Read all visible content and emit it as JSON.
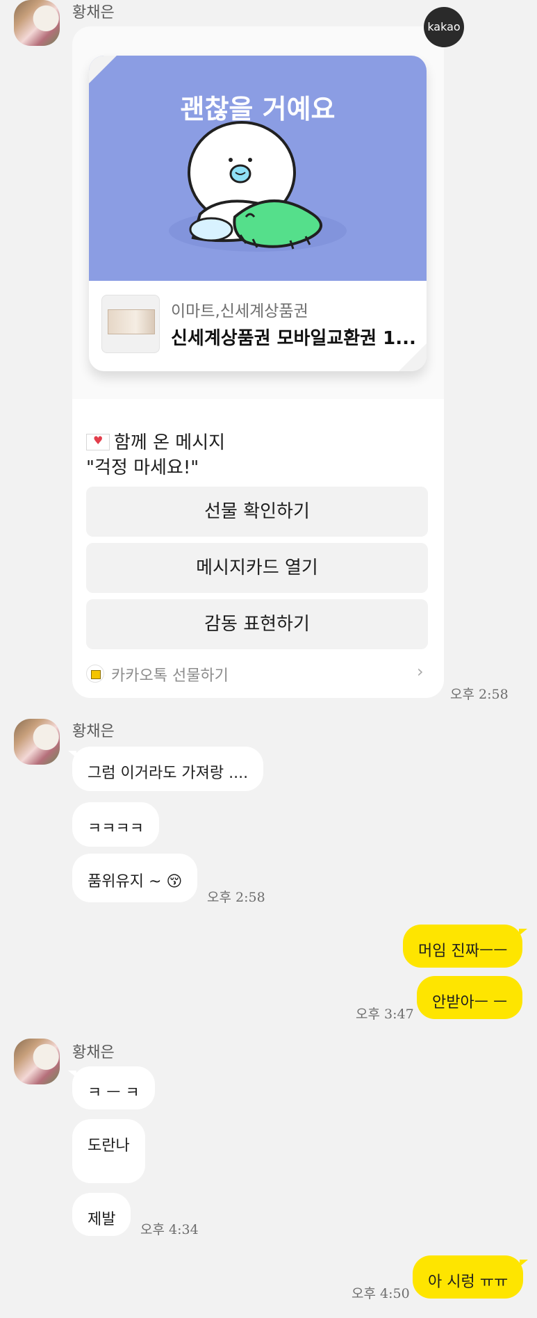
{
  "sender_name": "황채은",
  "gift_card": {
    "badge": "kakao",
    "image_title": "괜찮을 거예요",
    "brand": "이마트,신세계상품권",
    "product": "신세계상품권 모바일교환권 1...",
    "message_label": "함께 온 메시지",
    "message_text": "\"걱정 마세요!\"",
    "buttons": [
      "선물 확인하기",
      "메시지카드 열기",
      "감동 표현하기"
    ],
    "footer_text": "카카오톡 선물하기",
    "footer_chevron": "›",
    "time": "오후 2:58"
  },
  "group2": {
    "messages": [
      "그럼 이거라도 가져랑 ....",
      "ㅋㅋㅋㅋ",
      "품위유지 ~ 😚"
    ],
    "time": "오후 2:58"
  },
  "my_group1": {
    "messages": [
      "머임 진짜ㅡㅡ",
      "안받아ㅡ ㅡ"
    ],
    "time": "오후 3:47"
  },
  "group3": {
    "messages": [
      "ㅋ ㅡ ㅋ",
      "도란나",
      "제발"
    ],
    "time": "오후 4:34"
  },
  "my_group2": {
    "messages": [
      "아 시렁 ㅠㅠ"
    ],
    "time": "오후 4:50"
  },
  "colors": {
    "background": "#f2f2f2",
    "my_bubble": "#fee500",
    "their_bubble": "#ffffff",
    "gift_image_bg": "#8b9de3"
  }
}
